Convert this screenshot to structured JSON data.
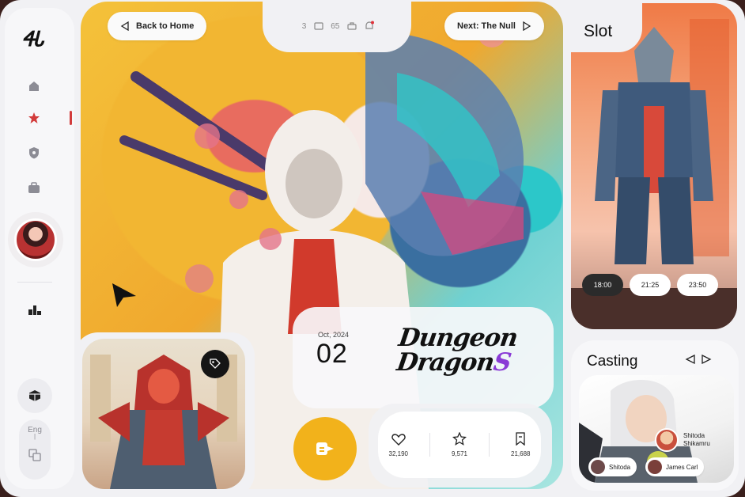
{
  "sidebar": {
    "logo_text": "ᏎᏓ",
    "nav_icons": [
      "home-icon",
      "star-icon",
      "shield-icon",
      "briefcase-icon"
    ],
    "active_index": 1,
    "rank_icon": "podium-icon",
    "language": "Eng",
    "accent": "#d23b3b"
  },
  "header": {
    "back_label": "Back to Home",
    "next_label": "Next: The Null",
    "stat_a": "3",
    "stat_b": "65"
  },
  "feature": {
    "date_small": "Oct, 2024",
    "date_big": "02",
    "title_line1": "Dungeon",
    "title_line2": "Dragon",
    "title_mark": "S",
    "button_color": "#f2b21b"
  },
  "stats": {
    "likes": "32,190",
    "stars": "9,571",
    "saves": "21,688"
  },
  "slot": {
    "label": "Slot",
    "times": [
      "18:00",
      "21:25",
      "23:50"
    ],
    "active_time_index": 0
  },
  "casting": {
    "label": "Casting",
    "featured_name_line1": "Shitoda",
    "featured_name_line2": "Shikamru",
    "actors": [
      "Shitoda",
      "James Carl"
    ]
  }
}
